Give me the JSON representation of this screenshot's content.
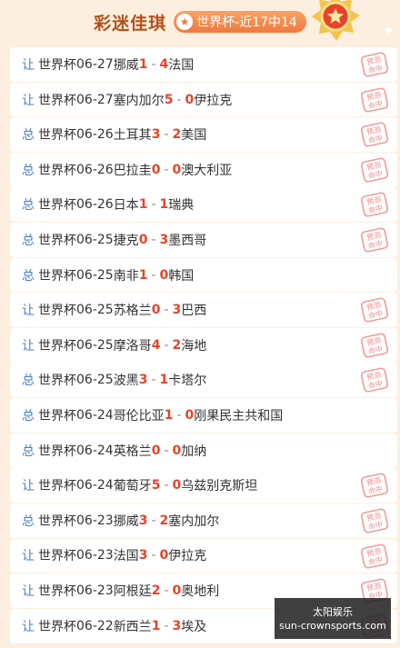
{
  "header": {
    "title": "彩迷佳琪",
    "badge_text": "世界杯-近17中14"
  },
  "stamp_text": [
    "预测",
    "命中"
  ],
  "matches": [
    {
      "tag": "让",
      "league": "世界杯",
      "date": "06-27",
      "home": "挪威",
      "home_score": "1",
      "away_score": "4",
      "away": "法国",
      "hit": true
    },
    {
      "tag": "让",
      "league": "世界杯",
      "date": "06-27",
      "home": "塞内加尔",
      "home_score": "5",
      "away_score": "0",
      "away": "伊拉克",
      "hit": true
    },
    {
      "tag": "总",
      "league": "世界杯",
      "date": "06-26",
      "home": "土耳其",
      "home_score": "3",
      "away_score": "2",
      "away": "美国",
      "hit": true
    },
    {
      "tag": "总",
      "league": "世界杯",
      "date": "06-26",
      "home": "巴拉圭",
      "home_score": "0",
      "away_score": "0",
      "away": "澳大利亚",
      "hit": true
    },
    {
      "tag": "总",
      "league": "世界杯",
      "date": "06-26",
      "home": "日本",
      "home_score": "1",
      "away_score": "1",
      "away": "瑞典",
      "hit": true
    },
    {
      "tag": "总",
      "league": "世界杯",
      "date": "06-25",
      "home": "捷克",
      "home_score": "0",
      "away_score": "3",
      "away": "墨西哥",
      "hit": true
    },
    {
      "tag": "总",
      "league": "世界杯",
      "date": "06-25",
      "home": "南非",
      "home_score": "1",
      "away_score": "0",
      "away": "韩国",
      "hit": false
    },
    {
      "tag": "让",
      "league": "世界杯",
      "date": "06-25",
      "home": "苏格兰",
      "home_score": "0",
      "away_score": "3",
      "away": "巴西",
      "hit": true
    },
    {
      "tag": "让",
      "league": "世界杯",
      "date": "06-25",
      "home": "摩洛哥",
      "home_score": "4",
      "away_score": "2",
      "away": "海地",
      "hit": true
    },
    {
      "tag": "总",
      "league": "世界杯",
      "date": "06-25",
      "home": "波黑",
      "home_score": "3",
      "away_score": "1",
      "away": "卡塔尔",
      "hit": true
    },
    {
      "tag": "总",
      "league": "世界杯",
      "date": "06-24",
      "home": "哥伦比亚",
      "home_score": "1",
      "away_score": "0",
      "away": "刚果民主共和国",
      "hit": false
    },
    {
      "tag": "总",
      "league": "世界杯",
      "date": "06-24",
      "home": "英格兰",
      "home_score": "0",
      "away_score": "0",
      "away": "加纳",
      "hit": false
    },
    {
      "tag": "让",
      "league": "世界杯",
      "date": "06-24",
      "home": "葡萄牙",
      "home_score": "5",
      "away_score": "0",
      "away": "乌兹别克斯坦",
      "hit": true
    },
    {
      "tag": "总",
      "league": "世界杯",
      "date": "06-23",
      "home": "挪威",
      "home_score": "3",
      "away_score": "2",
      "away": "塞内加尔",
      "hit": true
    },
    {
      "tag": "让",
      "league": "世界杯",
      "date": "06-23",
      "home": "法国",
      "home_score": "3",
      "away_score": "0",
      "away": "伊拉克",
      "hit": true
    },
    {
      "tag": "让",
      "league": "世界杯",
      "date": "06-23",
      "home": "阿根廷",
      "home_score": "2",
      "away_score": "0",
      "away": "奥地利",
      "hit": true
    },
    {
      "tag": "让",
      "league": "世界杯",
      "date": "06-22",
      "home": "新西兰",
      "home_score": "1",
      "away_score": "3",
      "away": "埃及",
      "hit": true
    }
  ],
  "watermark": {
    "line1": "太阳娱乐",
    "line2": "sun-crownsports.com"
  },
  "colors": {
    "accent": "#f0793e",
    "score": "#e8432a",
    "tag": "#4a7fcf",
    "title": "#b5501a",
    "background": "#fcefe0"
  }
}
